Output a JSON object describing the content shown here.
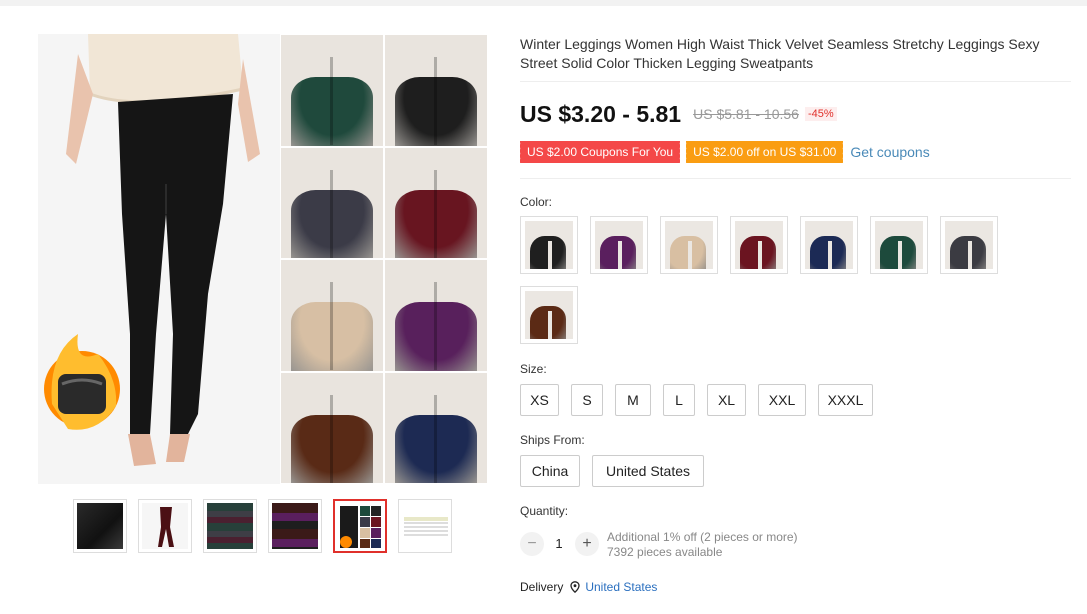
{
  "product": {
    "title": "Winter Leggings Women High Waist Thick Velvet Seamless Stretchy Leggings Sexy Street Solid Color Thicken Legging Sweatpants",
    "price": "US $3.20 - 5.81",
    "old_price": "US $5.81 - 10.56",
    "discount": "-45%"
  },
  "coupons": {
    "store_coupon": "US $2.00 Coupons For You",
    "order_coupon": "US $2.00 off on US $31.00",
    "link": "Get coupons"
  },
  "color": {
    "label": "Color:",
    "options": [
      {
        "name": "black",
        "color": "#1f1f1f"
      },
      {
        "name": "purple",
        "color": "#5a1f5e"
      },
      {
        "name": "skin",
        "color": "#d8bfa2"
      },
      {
        "name": "wine-red",
        "color": "#6b1420"
      },
      {
        "name": "navy",
        "color": "#1c2a55"
      },
      {
        "name": "dark-green",
        "color": "#1d4a3c"
      },
      {
        "name": "dark-gray",
        "color": "#3b3b42"
      },
      {
        "name": "coffee",
        "color": "#5b2a15"
      }
    ]
  },
  "size": {
    "label": "Size:",
    "options": [
      "XS",
      "S",
      "M",
      "L",
      "XL",
      "XXL",
      "XXXL"
    ]
  },
  "ships_from": {
    "label": "Ships From:",
    "options": [
      "China",
      "United States"
    ]
  },
  "quantity": {
    "label": "Quantity:",
    "value": "1",
    "minus": "−",
    "plus": "+",
    "note1": "Additional 1% off (2 pieces or more)",
    "note2": "7392 pieces available"
  },
  "delivery": {
    "label": "Delivery",
    "destination": "United States"
  },
  "gallery": {
    "grid_colors": [
      "#1d4a3c",
      "#1e1e1e",
      "#3b3b48",
      "#6b1420",
      "#d8bfa2",
      "#5a1f5e",
      "#5b2a15",
      "#1c2a55"
    ],
    "thumb_count": 6,
    "active_thumb": 5
  }
}
